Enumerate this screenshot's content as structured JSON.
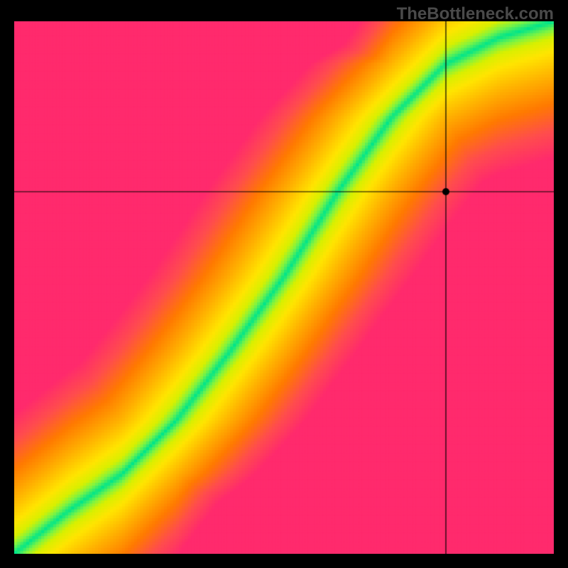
{
  "watermark": "TheBottleneck.com",
  "chart_data": {
    "type": "heatmap",
    "description": "Bottleneck heatmap with a green optimal ridge running diagonally from bottom-left to top-right, curving slightly. Colors transition from deep pink/red (worst) through orange and yellow to bright green (optimal). Crosshair lines mark a point in the upper-right region.",
    "xlim": [
      0,
      100
    ],
    "ylim": [
      0,
      100
    ],
    "crosshair": {
      "x": 80,
      "y": 68
    },
    "marker_radius": 5,
    "ridge_curve_note": "Green ridge approximates y = f(x) where optimal GPU/CPU balance lies; curve bows downward in middle.",
    "ridge_points": [
      {
        "x": 0,
        "y": 0
      },
      {
        "x": 10,
        "y": 8
      },
      {
        "x": 20,
        "y": 15
      },
      {
        "x": 30,
        "y": 25
      },
      {
        "x": 40,
        "y": 38
      },
      {
        "x": 50,
        "y": 52
      },
      {
        "x": 55,
        "y": 60
      },
      {
        "x": 60,
        "y": 68
      },
      {
        "x": 65,
        "y": 75
      },
      {
        "x": 70,
        "y": 82
      },
      {
        "x": 80,
        "y": 92
      },
      {
        "x": 90,
        "y": 97
      },
      {
        "x": 100,
        "y": 100
      }
    ],
    "color_stops": [
      {
        "d": 0.0,
        "color": "#00e58b"
      },
      {
        "d": 0.06,
        "color": "#7ef442"
      },
      {
        "d": 0.12,
        "color": "#d8f000"
      },
      {
        "d": 0.22,
        "color": "#ffe500"
      },
      {
        "d": 0.4,
        "color": "#ffb000"
      },
      {
        "d": 0.6,
        "color": "#ff7a00"
      },
      {
        "d": 0.8,
        "color": "#ff4d4d"
      },
      {
        "d": 1.0,
        "color": "#ff2a6d"
      }
    ]
  }
}
